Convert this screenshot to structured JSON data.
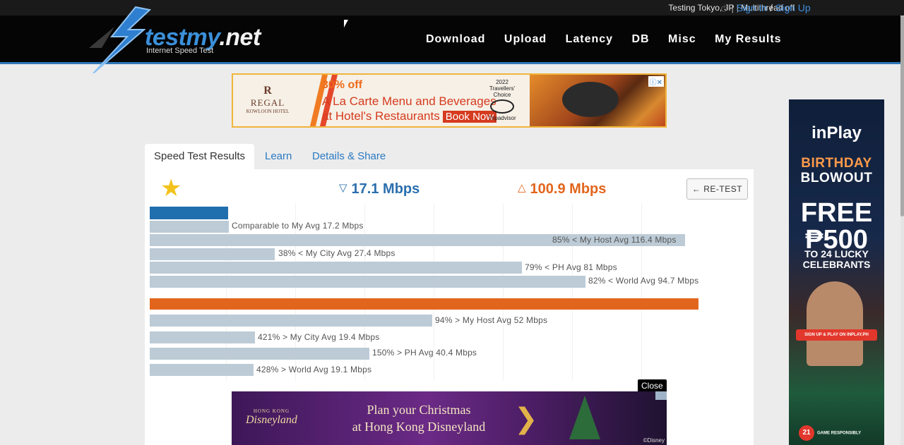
{
  "topbar": {
    "location": "Testing Tokyo, JP",
    "separator": "|",
    "multithread": "Multithread off",
    "sign_in": "Sign In",
    "slash": "/",
    "sign_up": "Sign Up"
  },
  "brand": {
    "name_main": "testmy",
    "name_tld": ".net",
    "tagline": "Internet Speed Test",
    "accent": "#3b8fd9"
  },
  "nav": [
    "Download",
    "Upload",
    "Latency",
    "DB",
    "Misc",
    "My Results"
  ],
  "ad_top": {
    "brand_line1": "R",
    "brand_line2": "REGAL",
    "brand_line3": "KOWLOON HOTEL",
    "offer": "30% off",
    "line1": "A La Carte Menu and Beverages",
    "line2": "at Hotel's Restaurants",
    "cta": "Book Now",
    "award_year": "2022",
    "award_title": "Travellers' Choice",
    "award_source": "Tripadvisor"
  },
  "tabs": [
    "Speed Test Results",
    "Learn",
    "Details & Share"
  ],
  "results": {
    "download": "17.1 Mbps",
    "upload": "100.9 Mbps",
    "retest": "← RE-TEST",
    "download_color": "#2b6fae",
    "upload_color": "#e2651d"
  },
  "comparisons": {
    "download": [
      {
        "label": "Comparable to My Avg 17.2 Mbps",
        "value": 17.2
      },
      {
        "label": "85% < My Host Avg 116.4 Mbps",
        "value": 116.4
      },
      {
        "label": "38% < My City Avg 27.4 Mbps",
        "value": 27.4
      },
      {
        "label": "79% < PH Avg 81 Mbps",
        "value": 81
      },
      {
        "label": "82% < World Avg 94.7 Mbps",
        "value": 94.7
      }
    ],
    "upload": [
      {
        "label": "94% > My Host Avg 52 Mbps",
        "value": 52
      },
      {
        "label": "421% > My City Avg 19.4 Mbps",
        "value": 19.4
      },
      {
        "label": "150% > PH Avg 40.4 Mbps",
        "value": 40.4
      },
      {
        "label": "428% > World Avg 19.1 Mbps",
        "value": 19.1
      }
    ]
  },
  "ad_close": "Close",
  "ad_bottom": {
    "logo_small": "HONG KONG",
    "logo": "Disneyland",
    "line1": "Plan your Christmas",
    "line2": "at Hong Kong Disneyland",
    "copyright": "©Disney"
  },
  "ad_side": {
    "brand": "inPlay",
    "headline1": "BIRTHDAY",
    "headline2": "BLOWOUT",
    "free": "FREE",
    "amount": "₱500",
    "sub1": "TO 24 LUCKY",
    "sub2": "CELEBRANTS",
    "cta": "SIGN UP & PLAY ON INPLAY.PH",
    "badge": "21",
    "responsible": "GAME RESPONSIBLY"
  }
}
